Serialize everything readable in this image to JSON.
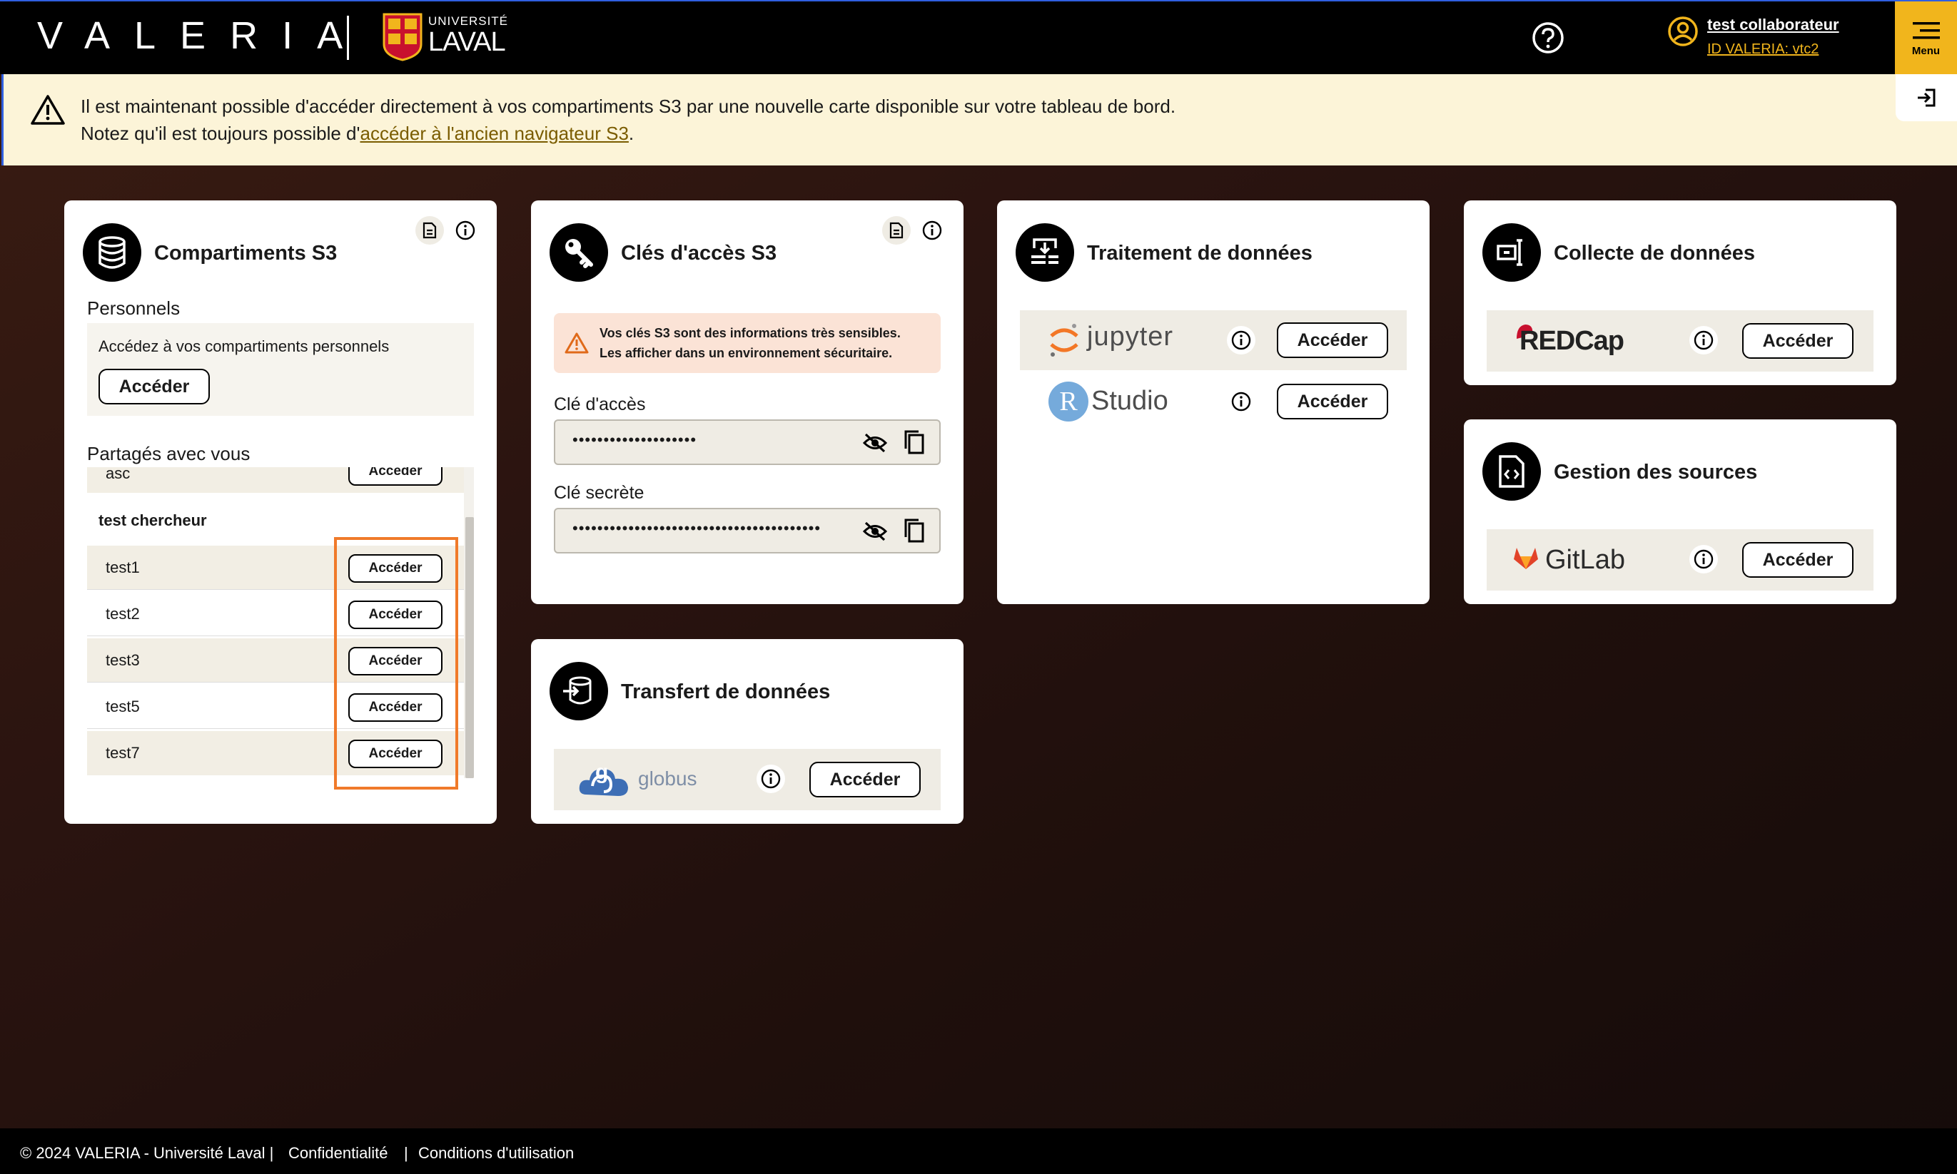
{
  "header": {
    "brand": "VALERIA",
    "university_small": "UNIVERSITÉ",
    "university_big": "LAVAL",
    "user_name": "test collaborateur",
    "user_id": "ID VALERIA: vtc2",
    "menu_label": "Menu"
  },
  "banner": {
    "line1": "Il est maintenant possible d'accéder directement à vos compartiments S3 par une nouvelle carte disponible sur votre tableau de bord.",
    "line2_prefix": "Notez qu'il est toujours possible d'",
    "line2_link": "accéder à l'ancien navigateur S3",
    "line2_suffix": "."
  },
  "s3": {
    "title": "Compartiments S3",
    "personal_heading": "Personnels",
    "personal_text": "Accédez à vos compartiments personnels",
    "personal_button": "Accéder",
    "shared_heading": "Partagés avec vous",
    "partial_row": {
      "name": "asc",
      "button": "Accéder"
    },
    "group_label": "test chercheur",
    "rows": [
      {
        "name": "test1",
        "button": "Accéder"
      },
      {
        "name": "test2",
        "button": "Accéder"
      },
      {
        "name": "test3",
        "button": "Accéder"
      },
      {
        "name": "test5",
        "button": "Accéder"
      },
      {
        "name": "test7",
        "button": "Accéder"
      }
    ]
  },
  "keys": {
    "title": "Clés d'accès S3",
    "warning_line1": "Vos clés S3 sont des informations très sensibles.",
    "warning_line2": "Les afficher dans un environnement sécuritaire.",
    "access_label": "Clé d'accès",
    "access_value": "••••••••••••••••••••",
    "secret_label": "Clé secrète",
    "secret_value": "••••••••••••••••••••••••••••••••••••••••"
  },
  "transfer": {
    "title": "Transfert de données",
    "tool_name": "globus",
    "button": "Accéder"
  },
  "processing": {
    "title": "Traitement de données",
    "jupyter_name": "jupyter",
    "jupyter_button": "Accéder",
    "rstudio_letter": "R",
    "rstudio_name": "Studio",
    "rstudio_button": "Accéder"
  },
  "collect": {
    "title": "Collecte de données",
    "tool_name": "REDCap",
    "button": "Accéder"
  },
  "sources": {
    "title": "Gestion des sources",
    "tool_name": "GitLab",
    "button": "Accéder"
  },
  "footer": {
    "copyright": "© 2024 VALERIA - Université Laval |",
    "privacy": "Confidentialité",
    "separator": "|",
    "terms": "Conditions d'utilisation"
  },
  "colors": {
    "accent": "#f1b51c",
    "highlight": "#f07a2a",
    "dark": "#000000",
    "warning_bg": "#fbe3d6"
  }
}
